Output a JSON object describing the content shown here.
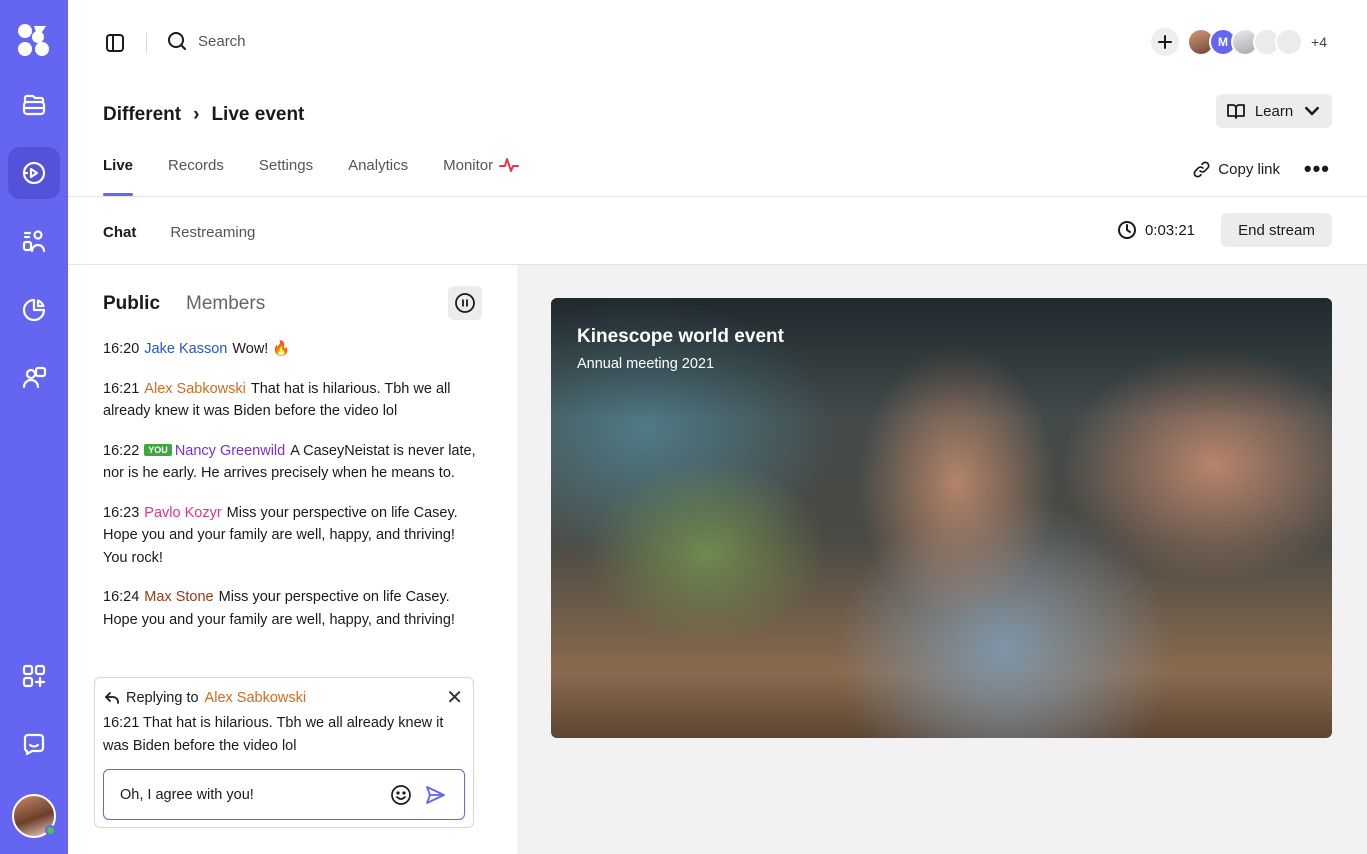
{
  "topbar": {
    "search_label": "Search",
    "participants": [
      {
        "initial": ""
      },
      {
        "initial": "M"
      },
      {
        "initial": ""
      },
      {
        "initial": ""
      },
      {
        "initial": ""
      }
    ],
    "more_count": "+4"
  },
  "header": {
    "breadcrumb": [
      "Different",
      "Live event"
    ],
    "learn_label": "Learn"
  },
  "tabs": [
    {
      "label": "Live",
      "active": true
    },
    {
      "label": "Records"
    },
    {
      "label": "Settings"
    },
    {
      "label": "Analytics"
    },
    {
      "label": "Monitor",
      "icon": "pulse-icon"
    }
  ],
  "actions": {
    "copy_link_label": "Copy link",
    "more_label": "•••"
  },
  "subtabs": [
    {
      "label": "Chat",
      "active": true
    },
    {
      "label": "Restreaming"
    }
  ],
  "stream": {
    "elapsed": "0:03:21",
    "end_label": "End stream"
  },
  "chat": {
    "tabs": [
      {
        "label": "Public",
        "active": true
      },
      {
        "label": "Members"
      }
    ],
    "messages": [
      {
        "time": "16:20",
        "name": "Jake Kasson",
        "color": "#2555d6",
        "text": "Wow! 🔥",
        "you": false
      },
      {
        "time": "16:21",
        "name": "Alex Sabkowski",
        "color": "#d46a1f",
        "text": "That hat is hilarious. Tbh we all already knew it was Biden before the video lol",
        "you": false
      },
      {
        "time": "16:22",
        "name": "Nancy Greenwild",
        "color": "#7a2fd6",
        "text": "A CaseyNeistat is never late, nor is he early. He arrives precisely when he means to.",
        "you": true,
        "you_label": "YOU"
      },
      {
        "time": "16:23",
        "name": "Pavlo Kozyr",
        "color": "#e0338d",
        "text": "Miss your perspective on life Casey. Hope you and your family are well, happy, and thriving! You rock!",
        "you": false
      },
      {
        "time": "16:24",
        "name": "Max Stone",
        "color": "#9a3a12",
        "text": "Miss your perspective on life Casey. Hope you and your family are well, happy, and thriving!",
        "you": false
      }
    ],
    "reply": {
      "prefix": "Replying to",
      "name": "Alex Sabkowski",
      "name_color": "#d46a1f",
      "quoted": "16:21  That hat is hilarious. Tbh we all already knew it was Biden before the video lol"
    },
    "input_value": "Oh, I agree with you!"
  },
  "video": {
    "title": "Kinescope world event",
    "subtitle": "Annual meeting 2021"
  },
  "colors": {
    "accent": "#6466f1",
    "pulse": "#e8344f",
    "online": "#4cc05a"
  }
}
